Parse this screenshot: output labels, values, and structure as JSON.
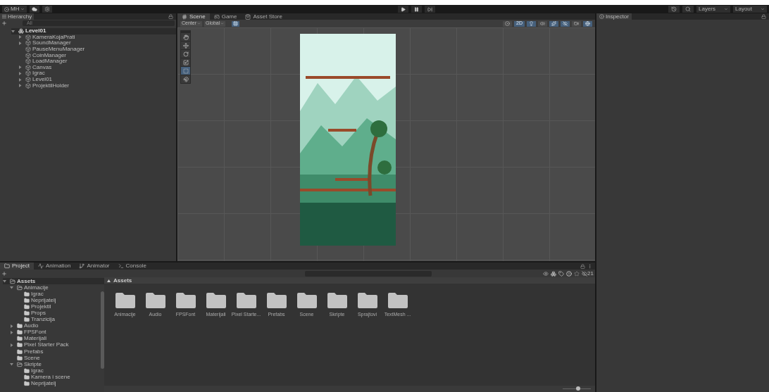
{
  "toolbar": {
    "account": "MH",
    "layers": "Layers",
    "layout": "Layout"
  },
  "hierarchy": {
    "title": "Hierarchy",
    "search": {
      "placeholder": "All"
    },
    "root": {
      "label": "Level01",
      "expandable": true,
      "expanded": true,
      "children": [
        {
          "label": "KameraKojaPrati",
          "expandable": true,
          "expanded": false
        },
        {
          "label": "SoundManager",
          "expandable": true,
          "expanded": false
        },
        {
          "label": "PauseMenuManager",
          "expandable": false,
          "expanded": false
        },
        {
          "label": "CoinManager",
          "expandable": false,
          "expanded": false
        },
        {
          "label": "LoadManager",
          "expandable": false,
          "expanded": false
        },
        {
          "label": "Canvas",
          "expandable": true,
          "expanded": false
        },
        {
          "label": "Igrac",
          "expandable": true,
          "expanded": false
        },
        {
          "label": "Level01",
          "expandable": true,
          "expanded": false
        },
        {
          "label": "ProjektilHolder",
          "expandable": true,
          "expanded": false
        }
      ]
    }
  },
  "scene": {
    "tabs": [
      {
        "label": "Scene",
        "kind": "scene",
        "selected": true
      },
      {
        "label": "Game",
        "kind": "game",
        "selected": false
      },
      {
        "label": "Asset Store",
        "kind": "store",
        "selected": false
      }
    ],
    "pivot": "Center",
    "space": "Global",
    "view_toggles": [
      {
        "kind": "shading",
        "on": false
      },
      {
        "kind": "dimension",
        "label": "2D",
        "on": true
      },
      {
        "kind": "lighting",
        "on": true
      },
      {
        "kind": "audio",
        "on": false
      },
      {
        "kind": "effects",
        "on": true
      },
      {
        "kind": "visibility",
        "on": true
      },
      {
        "kind": "camera",
        "on": false
      },
      {
        "kind": "gizmos",
        "on": true
      }
    ],
    "tools": [
      {
        "kind": "view",
        "selected": false
      },
      {
        "kind": "move",
        "selected": false
      },
      {
        "kind": "rotate",
        "selected": false
      },
      {
        "kind": "scale",
        "selected": false
      },
      {
        "kind": "rect",
        "selected": true
      },
      {
        "kind": "transform",
        "selected": false
      }
    ]
  },
  "inspector": {
    "title": "Inspector"
  },
  "bottom": {
    "tabs": [
      {
        "label": "Project",
        "kind": "project",
        "selected": true
      },
      {
        "label": "Animation",
        "kind": "animation",
        "selected": false
      },
      {
        "label": "Animator",
        "kind": "animator",
        "selected": false
      },
      {
        "label": "Console",
        "kind": "console",
        "selected": false
      }
    ],
    "tree": [
      {
        "label": "Assets",
        "expandable": true,
        "expanded": true,
        "children": [
          {
            "label": "Animacije",
            "expandable": true,
            "expanded": true,
            "children": [
              {
                "label": "Igrac",
                "expandable": false,
                "expanded": false
              },
              {
                "label": "Neprijatelj",
                "expandable": false,
                "expanded": false
              },
              {
                "label": "Projektil",
                "expandable": false,
                "expanded": false
              },
              {
                "label": "Props",
                "expandable": false,
                "expanded": false
              },
              {
                "label": "Tranzicija",
                "expandable": false,
                "expanded": false
              }
            ]
          },
          {
            "label": "Audio",
            "expandable": true,
            "expanded": false
          },
          {
            "label": "FPSFont",
            "expandable": true,
            "expanded": false
          },
          {
            "label": "Materijali",
            "expandable": false,
            "expanded": false
          },
          {
            "label": "Pixel Starter Pack",
            "expandable": true,
            "expanded": false
          },
          {
            "label": "Prefabs",
            "expandable": false,
            "expanded": false
          },
          {
            "label": "Scene",
            "expandable": false,
            "expanded": false
          },
          {
            "label": "Skripte",
            "expandable": true,
            "expanded": true,
            "children": [
              {
                "label": "Igrac",
                "expandable": false,
                "expanded": false
              },
              {
                "label": "Kamera i scene",
                "expandable": false,
                "expanded": false
              },
              {
                "label": "Neprijatelj",
                "expandable": false,
                "expanded": false
              }
            ]
          }
        ]
      }
    ],
    "breadcrumb": "Assets",
    "folders": [
      "Animacije",
      "Audio",
      "FPSFont",
      "Materijali",
      "Pixel Starte...",
      "Prefabs",
      "Scene",
      "Skripte",
      "Sprajtovi",
      "TextMesh ..."
    ],
    "hidden_count": "21",
    "icon_size": {
      "level": 0.55
    }
  }
}
